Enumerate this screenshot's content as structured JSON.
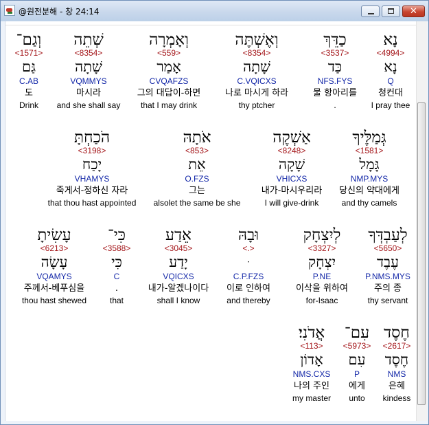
{
  "window": {
    "title": "@원전분해 - 창 24:14"
  },
  "rows": [
    [
      {
        "heb": "נָא",
        "strong": "<4994>",
        "lemma": "נָא",
        "code": "Q",
        "kor": "청컨대",
        "eng": "I pray thee"
      },
      {
        "heb": "כַדֵּךְ",
        "strong": "<3537>",
        "lemma": "כַּד",
        "code": "NFS.FYS",
        "kor": "물 항아리를",
        "eng": "."
      },
      {
        "heb": "וְאֶשְׁתֶּה",
        "strong": "<8354>",
        "lemma": "שָׁתָה",
        "code": "C.VQICXS",
        "kor": "나로 마시게 하라",
        "eng": "thy ptcher"
      },
      {
        "heb": "וְאָמְרָה",
        "strong": "<559>",
        "lemma": "אָמַר",
        "code": "CVQAFZS",
        "kor": "그의 대답이-하면",
        "eng": "that I may drink"
      },
      {
        "heb": "שְׁתֵה",
        "strong": "<8354>",
        "lemma": "שָׁתָה",
        "code": "VQMMYS",
        "kor": "마시라",
        "eng": "and she shall say"
      },
      {
        "heb": "וְגַם־",
        "strong": "<1571>",
        "lemma": "גַּם",
        "code": "C.AB",
        "kor": "도",
        "eng": "Drink"
      }
    ],
    [
      {
        "heb": "גְּמַלֶּיךָ",
        "strong": "<1581>",
        "lemma": "גָּמָל",
        "code": "NMP.MYS",
        "kor": "당신의 약대에게",
        "eng": "and thy camels"
      },
      {
        "heb": "אַשְׁקֶה",
        "strong": "<8248>",
        "lemma": "שָׁקָה",
        "code": "VHICXS",
        "kor": "내가-마시우리라",
        "eng": "I will give-drink"
      },
      {
        "heb": "אֹתָהּ",
        "strong": "<853>",
        "lemma": "אֵת",
        "code": "O.FZS",
        "kor": "그는",
        "eng": "alsolet the same be she"
      },
      {
        "heb": "הֹכַחְתָּ",
        "strong": "<3198>",
        "lemma": "יָכַח",
        "code": "VHAMYS",
        "kor": "죽게서-정하신 자라",
        "eng": "that thou hast appointed"
      }
    ],
    [
      {
        "heb": "לְעַבְדְּךָ",
        "strong": "<5650>",
        "lemma": "עֶבֶד",
        "code": "P.NMS.MYS",
        "kor": "주의 종",
        "eng": "thy servant"
      },
      {
        "heb": "לְיִצְחָק",
        "strong": "<3327>",
        "lemma": "יִצְחָק",
        "code": "P.NE",
        "kor": "이삭을 위하여",
        "eng": "for-Isaac"
      },
      {
        "heb": "וּבָהּ",
        "strong": "<.>",
        "lemma": "ּ",
        "code": "C.P.FZS",
        "kor": "이로 인하여",
        "eng": "and thereby"
      },
      {
        "heb": "אֵדַע",
        "strong": "<3045>",
        "lemma": "יָדַע",
        "code": "VQICXS",
        "kor": "내가-알겠나이다",
        "eng": "shall I know"
      },
      {
        "heb": "כִּי־",
        "strong": "<3588>",
        "lemma": "כִּי",
        "code": "C",
        "kor": ".",
        "eng": "that"
      },
      {
        "heb": "עָשִׂיתָ",
        "strong": "<6213>",
        "lemma": "עָשָׂה",
        "code": "VQAMYS",
        "kor": "주께서-베푸심을",
        "eng": "thou hast shewed"
      }
    ],
    [
      {
        "heb": "חֶסֶד",
        "strong": "<2617>",
        "lemma": "חֶסֶד",
        "code": "NMS",
        "kor": "은혜",
        "eng": "kindess"
      },
      {
        "heb": "עִם־",
        "strong": "<5973>",
        "lemma": "עִם",
        "code": "P",
        "kor": "에게",
        "eng": "unto"
      },
      {
        "heb": "אֲדֹנִי׃",
        "strong": "<113>",
        "lemma": "אָדוֹן",
        "code": "NMS.CXS",
        "kor": "나의 주인",
        "eng": "my master"
      }
    ]
  ]
}
